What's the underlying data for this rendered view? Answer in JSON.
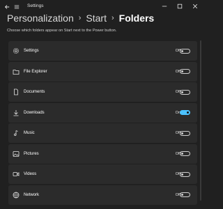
{
  "window": {
    "title": "Settings"
  },
  "breadcrumb": {
    "items": [
      "Personalization",
      "Start",
      "Folders"
    ],
    "separator": "›"
  },
  "description": "Choose which folders appear on Start next to the Power button.",
  "colors": {
    "accent": "#4cc2ff",
    "background": "#202020",
    "row": "#2b2b2b"
  },
  "folders": [
    {
      "label": "Settings",
      "icon": "gear-icon",
      "state": "Off",
      "on": false
    },
    {
      "label": "File Explorer",
      "icon": "file-explorer-icon",
      "state": "Off",
      "on": false
    },
    {
      "label": "Documents",
      "icon": "document-icon",
      "state": "Off",
      "on": false
    },
    {
      "label": "Downloads",
      "icon": "download-icon",
      "state": "On",
      "on": true
    },
    {
      "label": "Music",
      "icon": "music-icon",
      "state": "Off",
      "on": false
    },
    {
      "label": "Pictures",
      "icon": "picture-icon",
      "state": "Off",
      "on": false
    },
    {
      "label": "Videos",
      "icon": "video-icon",
      "state": "Off",
      "on": false
    },
    {
      "label": "Network",
      "icon": "network-icon",
      "state": "Off",
      "on": false
    }
  ]
}
